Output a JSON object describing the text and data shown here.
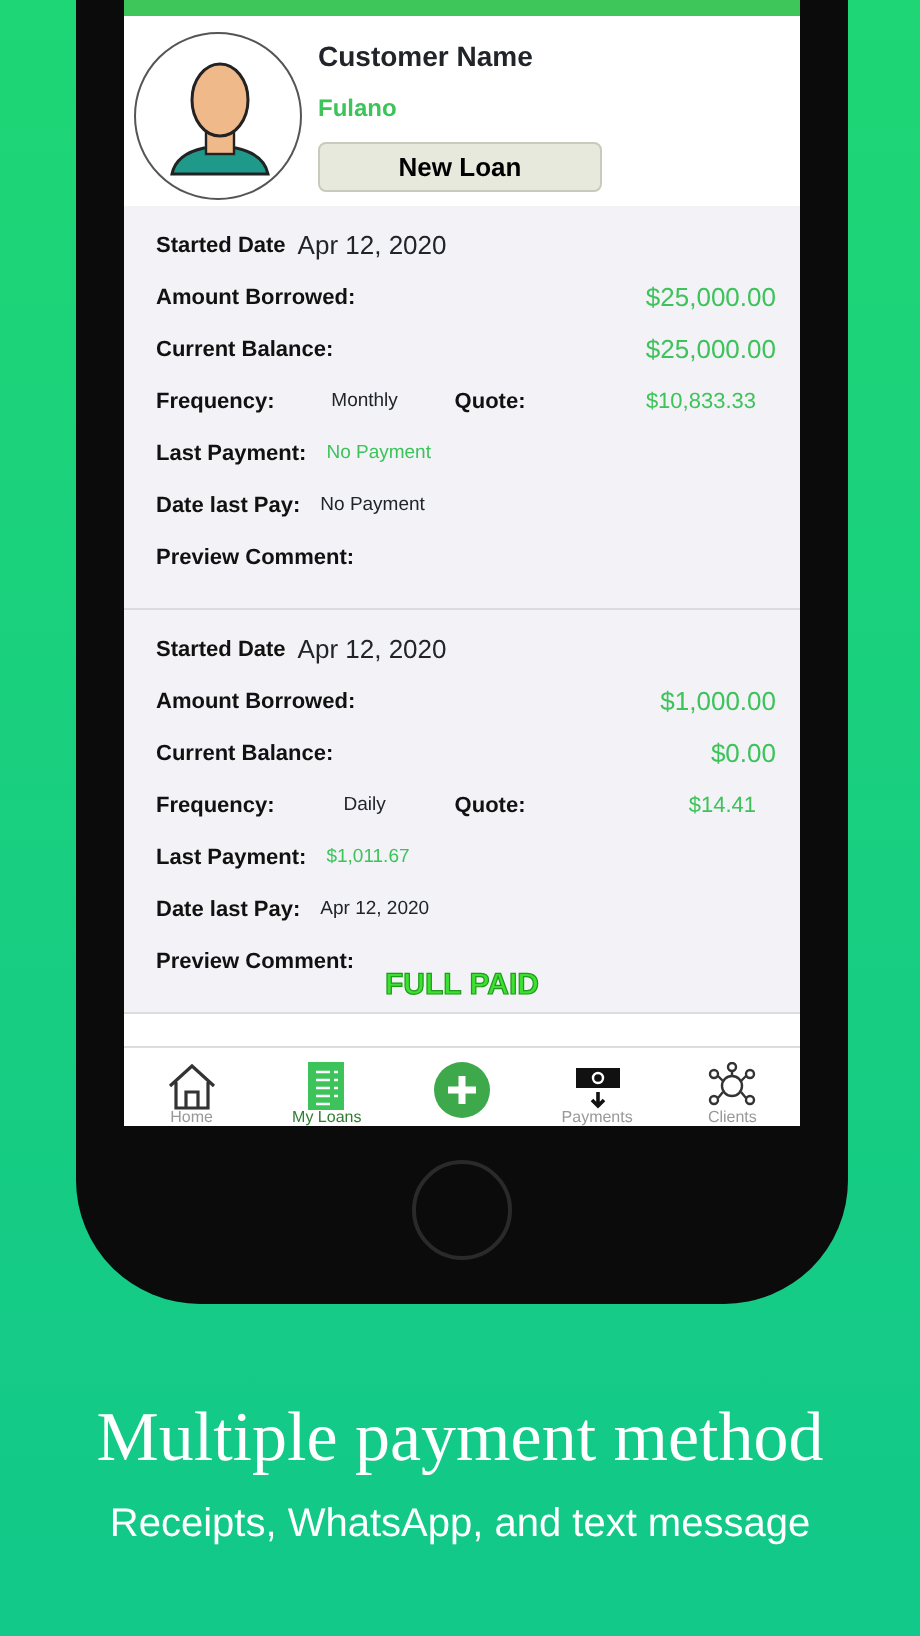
{
  "customer": {
    "label": "Customer Name",
    "name": "Fulano",
    "button": "New Loan"
  },
  "loans": [
    {
      "started": {
        "label": "Started Date",
        "value": "Apr 12, 2020"
      },
      "amount_borrowed": {
        "label": "Amount Borrowed:",
        "value": "$25,000.00"
      },
      "current_balance": {
        "label": "Current Balance:",
        "value": "$25,000.00"
      },
      "frequency": {
        "label": "Frequency:",
        "value": "Monthly"
      },
      "quote": {
        "label": "Quote:",
        "value": "$10,833.33"
      },
      "last_payment": {
        "label": "Last Payment:",
        "value": "No Payment"
      },
      "date_last_pay": {
        "label": "Date last Pay:",
        "value": "No Payment"
      },
      "preview_comment": {
        "label": "Preview Comment:"
      }
    },
    {
      "started": {
        "label": "Started Date",
        "value": "Apr 12, 2020"
      },
      "amount_borrowed": {
        "label": "Amount Borrowed:",
        "value": "$1,000.00"
      },
      "current_balance": {
        "label": "Current Balance:",
        "value": "$0.00"
      },
      "frequency": {
        "label": "Frequency:",
        "value": "Daily"
      },
      "quote": {
        "label": "Quote:",
        "value": "$14.41"
      },
      "last_payment": {
        "label": "Last Payment:",
        "value": "$1,011.67"
      },
      "date_last_pay": {
        "label": "Date last Pay:",
        "value": "Apr 12, 2020"
      },
      "preview_comment": {
        "label": "Preview Comment:"
      },
      "stamp": "FULL PAID"
    }
  ],
  "tab_bar": [
    {
      "kind": "home",
      "label": "Home",
      "selected": false
    },
    {
      "kind": "loans",
      "label": "My Loans",
      "selected": true
    },
    {
      "kind": "add"
    },
    {
      "kind": "payments",
      "label": "Payments",
      "selected": false
    },
    {
      "kind": "clients",
      "label": "Clients",
      "selected": false
    }
  ],
  "caption": {
    "title": "Multiple payment method",
    "subtitle": "Receipts, WhatsApp, and text message"
  }
}
